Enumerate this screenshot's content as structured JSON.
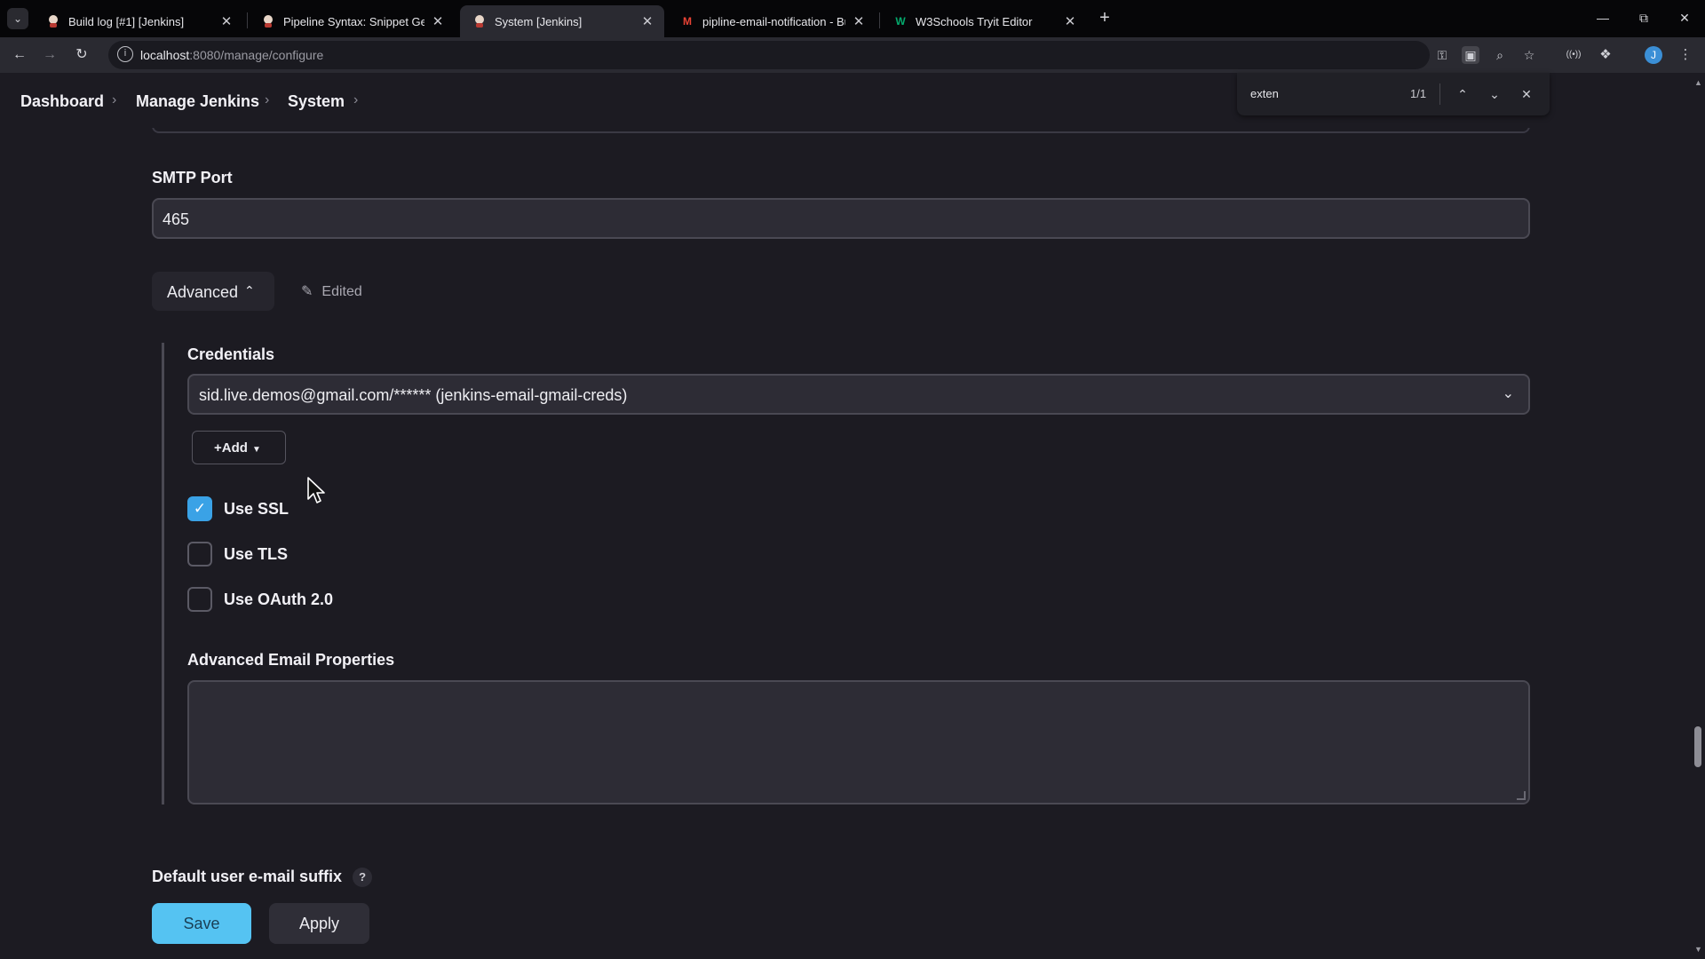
{
  "browser": {
    "tabs": [
      {
        "title": "Build log [#1] [Jenkins]",
        "favicon": "jenkins-icon",
        "active": false
      },
      {
        "title": "Pipeline Syntax: Snippet Genera",
        "favicon": "jenkins-icon",
        "active": false
      },
      {
        "title": "System [Jenkins]",
        "favicon": "jenkins-icon",
        "active": true
      },
      {
        "title": "pipline-email-notification - Buil",
        "favicon": "gmail-icon",
        "active": false
      },
      {
        "title": "W3Schools Tryit Editor",
        "favicon": "w3schools-icon",
        "active": false
      }
    ],
    "url_host": "localhost",
    "url_path": ":8080/manage/configure",
    "find": {
      "query": "exten",
      "count": "1/1"
    }
  },
  "breadcrumb": [
    "Dashboard",
    "Manage Jenkins",
    "System"
  ],
  "form": {
    "smtp_port_label": "SMTP Port",
    "smtp_port_value": "465",
    "advanced_label": "Advanced",
    "edited_label": "Edited",
    "credentials_label": "Credentials",
    "credentials_value": "sid.live.demos@gmail.com/****** (jenkins-email-gmail-creds)",
    "add_label": "Add",
    "checkboxes": [
      {
        "label": "Use SSL",
        "checked": true
      },
      {
        "label": "Use TLS",
        "checked": false
      },
      {
        "label": "Use OAuth 2.0",
        "checked": false
      }
    ],
    "advanced_email_properties_label": "Advanced Email Properties",
    "advanced_email_properties_value": "",
    "default_suffix_label": "Default user e-mail suffix",
    "help_glyph": "?"
  },
  "actions": {
    "save_label": "Save",
    "apply_label": "Apply"
  },
  "colors": {
    "save_button": "#55c3f2",
    "checkbox_checked": "#3aa2e6",
    "page_background": "#1c1b22"
  }
}
